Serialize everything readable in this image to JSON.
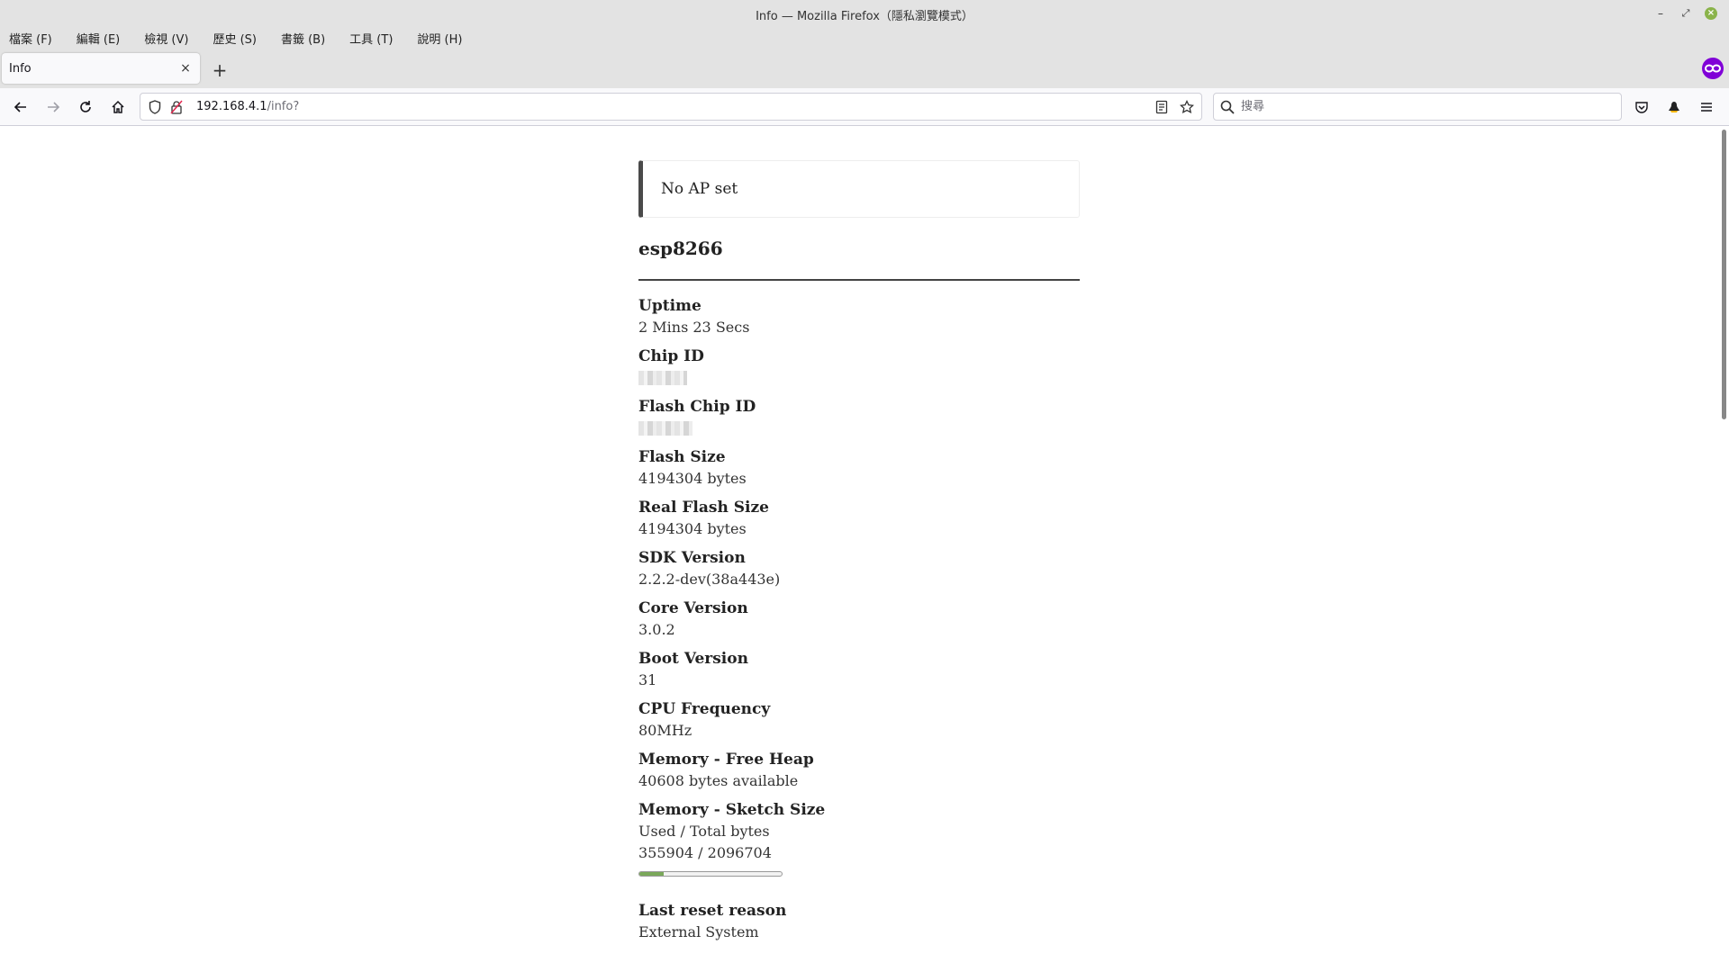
{
  "window": {
    "title": "Info — Mozilla Firefox（隱私瀏覽模式）",
    "controls": {
      "minimize": "–",
      "maximize": "⤢",
      "close": "×"
    }
  },
  "menubar": {
    "items": [
      "檔案 (F)",
      "編輯 (E)",
      "檢視 (V)",
      "歷史 (S)",
      "書籤 (B)",
      "工具 (T)",
      "說明 (H)"
    ]
  },
  "tabs": {
    "active_title": "Info",
    "close": "×",
    "new_tab": "+"
  },
  "navbar": {
    "url_host": "192.168.4.1",
    "url_path": "/info?",
    "search_placeholder": "搜尋"
  },
  "page": {
    "notice": "No AP set",
    "device_name": "esp8266",
    "info": {
      "uptime": {
        "label": "Uptime",
        "value": "2 Mins 23 Secs"
      },
      "chip_id": {
        "label": "Chip ID",
        "value": ""
      },
      "flash_chip_id": {
        "label": "Flash Chip ID",
        "value": ""
      },
      "flash_size": {
        "label": "Flash Size",
        "value": "4194304 bytes"
      },
      "real_flash_size": {
        "label": "Real Flash Size",
        "value": "4194304 bytes"
      },
      "sdk_version": {
        "label": "SDK Version",
        "value": "2.2.2-dev(38a443e)"
      },
      "core_version": {
        "label": "Core Version",
        "value": "3.0.2"
      },
      "boot_version": {
        "label": "Boot Version",
        "value": "31"
      },
      "cpu_frequency": {
        "label": "CPU Frequency",
        "value": "80MHz"
      },
      "free_heap": {
        "label": "Memory - Free Heap",
        "value": "40608 bytes available"
      },
      "sketch_size": {
        "label": "Memory - Sketch Size",
        "subtitle": "Used / Total bytes",
        "value": "355904 / 2096704",
        "used_fraction": 0.17
      },
      "last_reset": {
        "label": "Last reset reason",
        "value": "External System"
      }
    }
  },
  "colors": {
    "private_badge": "#8000d7",
    "progress_fill": "#7aa85a"
  }
}
